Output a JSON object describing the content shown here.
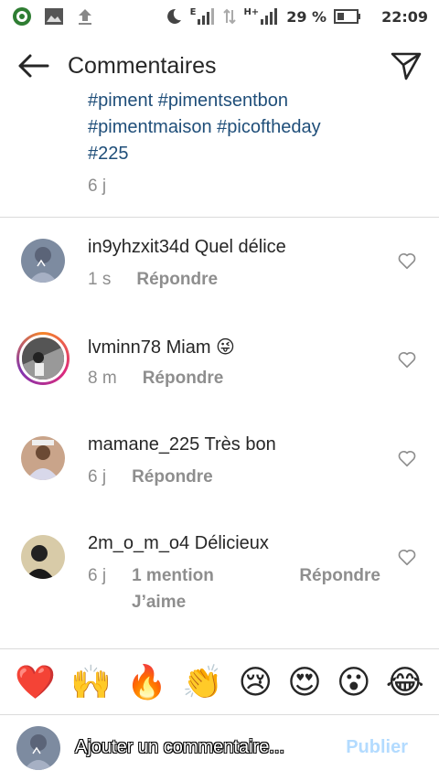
{
  "status_bar": {
    "battery_percent": "29 %",
    "time": "22:09",
    "signal_label_1": "E",
    "signal_label_2": "H+"
  },
  "header": {
    "title": "Commentaires"
  },
  "caption": {
    "lines": [
      "#piment #pimentsentbon",
      "#pimentmaison #picoftheday",
      "#225"
    ],
    "time": "6 j"
  },
  "comments": [
    {
      "username": "in9yhzxit34d",
      "text": "Quel délice",
      "time": "1 s",
      "reply_label": "Répondre"
    },
    {
      "username": "lvminn78",
      "text": "Miam 😜",
      "time": "8 m",
      "reply_label": "Répondre"
    },
    {
      "username": "mamane_225",
      "text": "Très bon",
      "time": "6 j",
      "reply_label": "Répondre"
    },
    {
      "username": "2m_o_m_o4",
      "text": "Délicieux",
      "time": "6 j",
      "mention_label": "1 mention",
      "reply_label": "Répondre",
      "like_label": "J’aime"
    }
  ],
  "emoji_bar": [
    "❤️",
    "🙌",
    "🔥",
    "👏",
    "😢",
    "😍",
    "😮",
    "😂"
  ],
  "composer": {
    "placeholder": "Ajouter un commentaire...",
    "publish_label": "Publier"
  },
  "colors": {
    "hashtag": "#1f4e79",
    "meta_gray": "#8e8e8e",
    "publish_disabled": "#b3dbff",
    "divider": "#dbdbdb"
  }
}
